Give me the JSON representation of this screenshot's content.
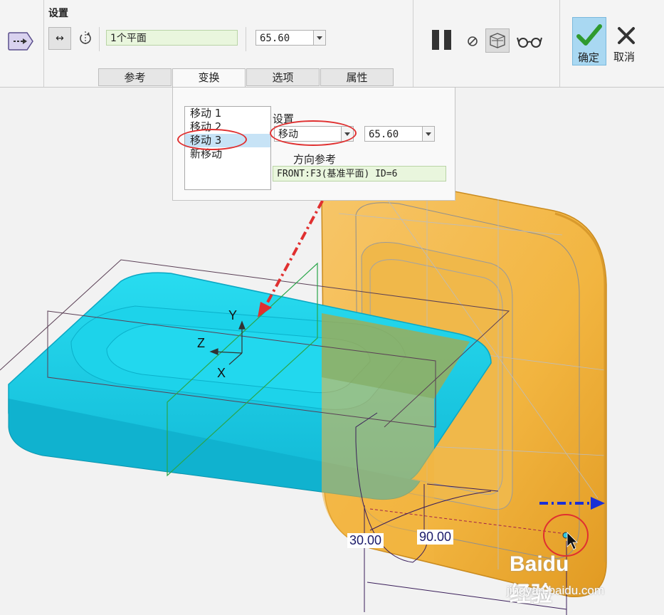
{
  "ribbon": {
    "title": "设置",
    "references_value": "1个平面",
    "value": "65.60",
    "ok_label": "确定",
    "cancel_label": "取消"
  },
  "tabs": [
    {
      "label": "参考"
    },
    {
      "label": "变换",
      "active": true
    },
    {
      "label": "选项"
    },
    {
      "label": "属性"
    }
  ],
  "transform_panel": {
    "moves": [
      "移动 1",
      "移动 2",
      "移动 3",
      "新移动"
    ],
    "selected_index": 2,
    "settings_label": "设置",
    "type_value": "移动",
    "distance_value": "65.60",
    "direction_ref_label": "方向参考",
    "direction_ref_value": "FRONT:F3(基准平面) ID=6"
  },
  "viewport": {
    "axis_y": "Y",
    "axis_z": "Z",
    "axis_x": "X",
    "dim_angle_1": "30.00",
    "dim_angle_2": "90.00"
  },
  "watermark": {
    "brand": "Baidu经验",
    "url": "jingyan.baidu.com"
  },
  "colors": {
    "accent_ok": "#a9d8f2",
    "annotation_red": "#e03030",
    "annotation_blue": "#1a2fd6",
    "part_cyan": "#19cfe6",
    "part_orange": "#f2b540"
  }
}
